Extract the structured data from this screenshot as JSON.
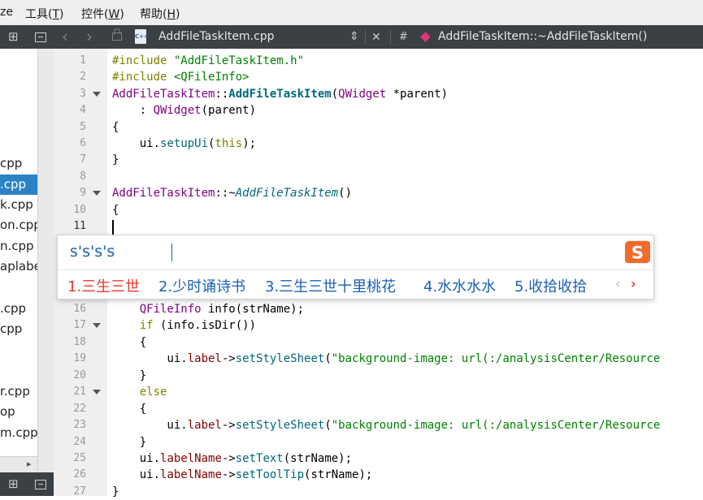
{
  "menu": {
    "items": [
      {
        "label": "ze",
        "shortcut": ""
      },
      {
        "label": "工具(",
        "key": "T",
        "suffix": ")"
      },
      {
        "label": "控件(",
        "key": "W",
        "suffix": ")"
      },
      {
        "label": "帮助(",
        "key": "H",
        "suffix": ")"
      }
    ]
  },
  "editor_toolbar": {
    "file_name": "AddFileTaskItem.cpp",
    "file_type_badge": "C++",
    "hash_symbol": "#",
    "function_name": "AddFileTaskItem::~AddFileTaskItem()"
  },
  "sidebar": {
    "files": [
      {
        "label": "cpp",
        "selected": false
      },
      {
        "label": ".cpp",
        "selected": true
      },
      {
        "label": "k.cpp",
        "selected": false
      },
      {
        "label": "on.cpp",
        "selected": false
      },
      {
        "label": "n.cpp",
        "selected": false
      },
      {
        "label": "aplabe",
        "selected": false
      },
      {
        "label": "",
        "selected": false
      },
      {
        "label": ".cpp",
        "selected": false
      },
      {
        "label": "cpp",
        "selected": false
      },
      {
        "label": "",
        "selected": false
      },
      {
        "label": "",
        "selected": false
      },
      {
        "label": "r.cpp",
        "selected": false
      },
      {
        "label": "op",
        "selected": false
      },
      {
        "label": "m.cpp",
        "selected": false
      }
    ]
  },
  "code": {
    "line_numbers": [
      "1",
      "2",
      "3",
      "4",
      "5",
      "6",
      "7",
      "8",
      "9",
      "10",
      "11",
      "16",
      "17",
      "18",
      "19",
      "20",
      "21",
      "22",
      "23",
      "24",
      "25",
      "26",
      "27"
    ],
    "current_line": "11",
    "l1_kw": "#include",
    "l1_str": " \"AddFileTaskItem.h\"",
    "l2_kw": "#include",
    "l2_str": " <QFileInfo>",
    "l3_cls": "AddFileTaskItem",
    "l3_sep": "::",
    "l3_fn": "AddFileTaskItem",
    "l3_open": "(",
    "l3_type": "QWidget",
    "l3_rest": " *parent)",
    "l4_pre": "    : ",
    "l4_type": "QWidget",
    "l4_rest": "(parent)",
    "l5": "{",
    "l6_pre": "    ui.",
    "l6_fn": "setupUi",
    "l6_open": "(",
    "l6_kw": "this",
    "l6_rest": ");",
    "l7": "}",
    "l9_cls": "AddFileTaskItem",
    "l9_sep": "::~",
    "l9_fn": "AddFileTaskItem",
    "l9_rest": "()",
    "l10": "{",
    "l15": "{",
    "l16_pre": "    ",
    "l16_type": "QFileInfo",
    "l16_rest": " info(strName);",
    "l17_pre": "    ",
    "l17_kw": "if",
    "l17_rest": " (info.isDir())",
    "l18": "    {",
    "l19_pre": "        ui.",
    "l19_mem": "label",
    "l19_arrow": "->",
    "l19_fn": "setStyleSheet",
    "l19_open": "(",
    "l19_str": "\"background-image: url(:/analysisCenter/Resource",
    "l20": "    }",
    "l21_pre": "    ",
    "l21_kw": "else",
    "l22": "    {",
    "l23_pre": "        ui.",
    "l23_mem": "label",
    "l23_arrow": "->",
    "l23_fn": "setStyleSheet",
    "l23_open": "(",
    "l23_str": "\"background-image: url(:/analysisCenter/Resource",
    "l24": "    }",
    "l25_pre": "    ui.",
    "l25_mem": "labelName",
    "l25_arrow": "->",
    "l25_fn": "setText",
    "l25_rest": "(strName);",
    "l26_pre": "    ui.",
    "l26_mem": "labelName",
    "l26_arrow": "->",
    "l26_fn": "setToolTip",
    "l26_rest": "(strName);",
    "l27": "}"
  },
  "ime": {
    "pinyin": "s's's's",
    "candidates": [
      "1.三生三世",
      "2.少时诵诗书",
      "3.三生三世十里桃花",
      "4.水水水水",
      "5.收拾收拾"
    ],
    "prev_glyph": "‹",
    "next_glyph": "›",
    "logo_letter": "S"
  },
  "icons": {
    "split": "⊞",
    "nav_back": "‹",
    "nav_forward": "›",
    "lock": "🔒",
    "updown": "⇕",
    "close": "✕",
    "scroll_right": "▸"
  },
  "colors": {
    "accent": "#2b83c6",
    "ime_candidate": "#1c5fb8",
    "ime_first": "#e8382a",
    "logo": "#f26b2a"
  }
}
